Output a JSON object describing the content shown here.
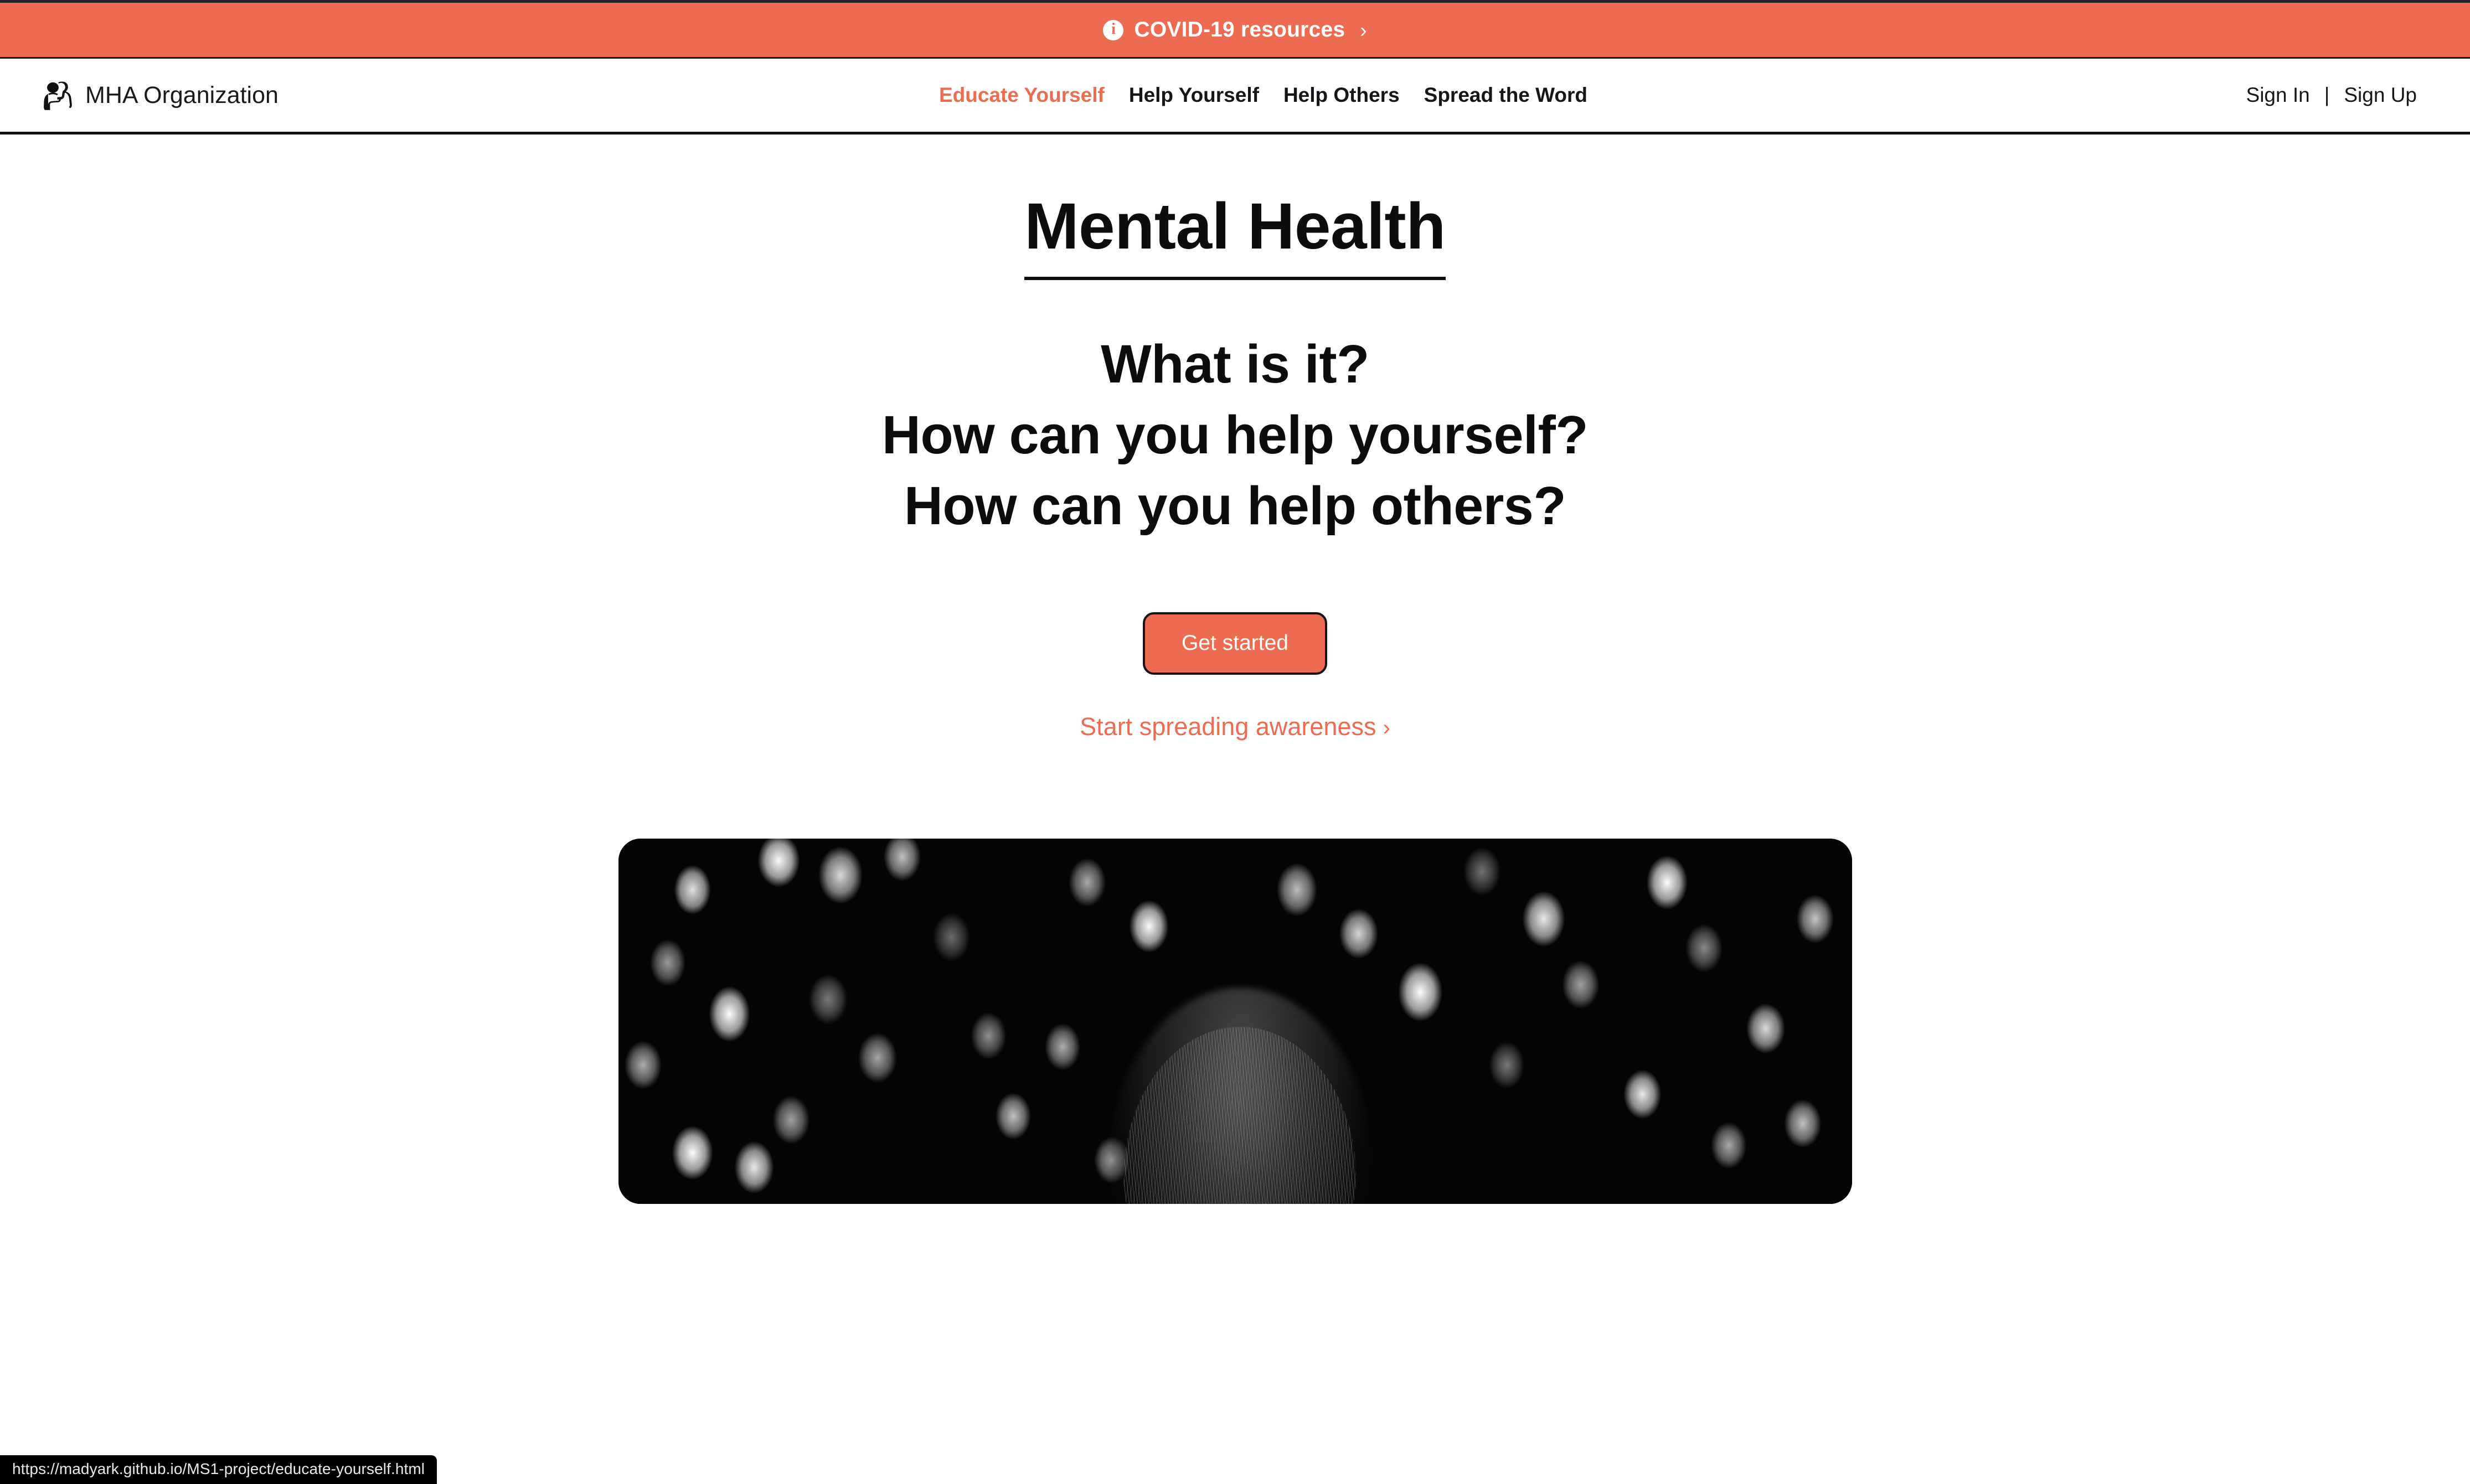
{
  "colors": {
    "accent": "#EC6B51",
    "text": "#16161a",
    "banner_bg": "#EC6B51",
    "button_border": "#14141a",
    "status_bar_bg": "#000000"
  },
  "covid_banner": {
    "icon": "info-circle-icon",
    "text": "COVID-19 resources",
    "chevron": "›"
  },
  "navbar": {
    "brand": {
      "logo_icon": "two-people-embracing-logo",
      "name": "MHA Organization"
    },
    "links": [
      {
        "label": "Educate Yourself",
        "active": true
      },
      {
        "label": "Help Yourself",
        "active": false
      },
      {
        "label": "Help Others",
        "active": false
      },
      {
        "label": "Spread the Word",
        "active": false
      }
    ],
    "auth": {
      "sign_in": "Sign In",
      "divider": "|",
      "sign_up": "Sign Up"
    }
  },
  "hero": {
    "page_title": "Mental Health",
    "questions": [
      "What is it?",
      "How can you help yourself?",
      "How can you help others?"
    ],
    "get_started_label": "Get started",
    "awareness_link": "Start spreading awareness",
    "awareness_chevron": "›",
    "image_alt": "black-and-white-bokeh-portrait"
  },
  "status_bar": {
    "url": "https://madyark.github.io/MS1-project/educate-yourself.html"
  }
}
